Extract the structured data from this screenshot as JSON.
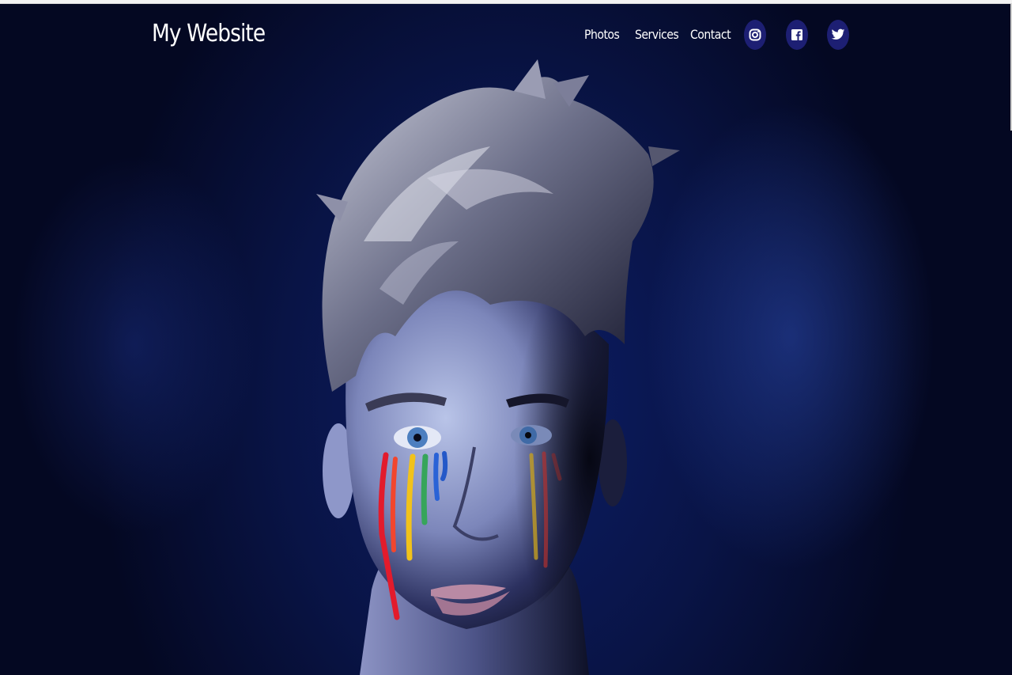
{
  "header": {
    "brand": "My Website",
    "nav": [
      {
        "label": "Photos"
      },
      {
        "label": "Services"
      },
      {
        "label": "Contact"
      }
    ],
    "social": [
      {
        "icon": "instagram-icon"
      },
      {
        "icon": "facebook-icon"
      },
      {
        "icon": "twitter-icon"
      }
    ]
  },
  "hero": {
    "image_subject": "portrait",
    "colors": {
      "background": "#091446",
      "social_button": "#1d1f73",
      "text": "#ffffff"
    }
  }
}
